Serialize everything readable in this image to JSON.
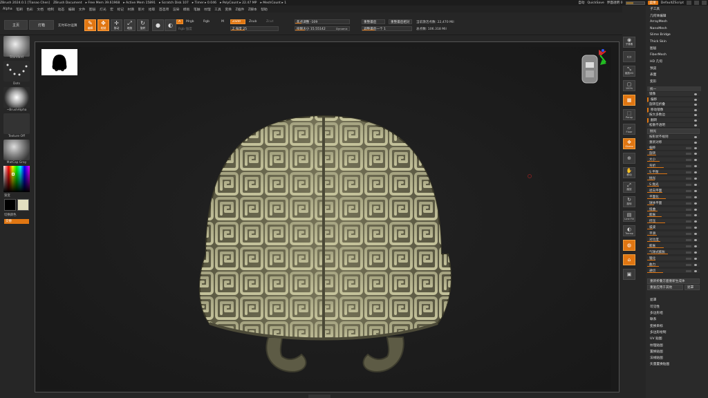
{
  "titlebar": {
    "items": [
      "ZBrush 2024.0.1 [Tianao Chen]",
      "ZBrush Document",
      "▸ Free Mem 39.61968",
      "▸ Active Mem 15891",
      "▸ Scratch Disk 107",
      "▸ Timer ▸ 0.046",
      "▸ PolyCount ▸ 22.47 MP",
      "▸ MeshCount ▸ 1"
    ]
  },
  "topright": {
    "autosave": "自动",
    "quicksave": "QuickSave",
    "transparency": "界面透明 0",
    "menus_btn": "菜单",
    "script": "DefaultZScript"
  },
  "menubar": {
    "items": [
      "Alpha",
      "笔刷",
      "色彩",
      "文档",
      "绘制",
      "动态",
      "编辑",
      "文件",
      "图层",
      "灯光",
      "宏",
      "标记",
      "材质",
      "影片",
      "拾取",
      "首选项",
      "渲染",
      "模板",
      "笔触",
      "纹理",
      "工具",
      "变换",
      "Z插件",
      "Z脚本",
      "帮助"
    ]
  },
  "toolbar": {
    "home": "主页",
    "lightbox": "灯箱",
    "live_boolean": "实时布尔运算",
    "tools": [
      {
        "label": "编辑",
        "glyph": "✎",
        "active": true
      },
      {
        "label": "绘制",
        "glyph": "✥",
        "active": true
      },
      {
        "label": "移动",
        "glyph": "✛",
        "active": false
      },
      {
        "label": "缩放",
        "glyph": "⤢",
        "active": false
      },
      {
        "label": "旋转",
        "glyph": "↻",
        "active": false
      }
    ],
    "a_label": "A",
    "mrgb": "Mrgb",
    "rgb": "Rgb",
    "m": "M",
    "rgb_intensity": "Rgb 强度",
    "zadd": "Zadd",
    "zsub": "Zsub",
    "zcut": "Zcut",
    "z_intensity": "Z 强度 25",
    "focal_shift": "焦点调整 -109",
    "draw_size": "绘制大小 15.55142",
    "dynamic": "Dynamic",
    "remap_prev": "重整最后",
    "remap_rel": "重整最后相对",
    "active_points": "当前激活点数: 22,470 Mil",
    "adjust_last": "调整最后一个 1",
    "total_points": "总点数: 106.318 Mil"
  },
  "leftshelf": {
    "brush": "Standard",
    "stroke": "Dots",
    "alpha": "~BrushAlpha",
    "texture": "Texture Off",
    "material": "MatCap Gray",
    "gradient": "渐变",
    "swap_color": "切换颜色",
    "alternate": "交替"
  },
  "rightstrip": {
    "icons": [
      {
        "label": "子像素",
        "glyph": "◉",
        "active": false
      },
      {
        "label": "",
        "glyph": "▭",
        "active": false
      },
      {
        "label": "缩放2D",
        "glyph": "⤡",
        "active": false
      },
      {
        "label": "100%",
        "glyph": "▢",
        "active": false
      },
      {
        "label": "",
        "glyph": "▦",
        "active": true
      },
      {
        "label": "Persp",
        "glyph": "⬚",
        "active": false
      },
      {
        "label": "Floor",
        "glyph": "▱",
        "active": false
      },
      {
        "label": "Gizmo",
        "glyph": "✥",
        "active": true
      },
      {
        "label": "",
        "glyph": "⊕",
        "active": false
      },
      {
        "label": "移动",
        "glyph": "✋",
        "active": false
      },
      {
        "label": "缩放",
        "glyph": "⤢",
        "active": false
      },
      {
        "label": "旋转",
        "glyph": "↻",
        "active": false
      },
      {
        "label": "Line Fill",
        "glyph": "▤",
        "active": false
      },
      {
        "label": "Transp",
        "glyph": "◐",
        "active": false
      },
      {
        "label": "",
        "glyph": "◍",
        "active": true
      },
      {
        "label": "",
        "glyph": "⌂",
        "active": true
      },
      {
        "label": "",
        "glyph": "▣",
        "active": false
      }
    ]
  },
  "palette": {
    "top_items": [
      "子工具",
      "几何体编辑",
      "ArrayMesh",
      "NanoMesh",
      "Slime Bridge",
      "Thick Skin",
      "图层",
      "FiberMesh",
      "HD 几何",
      "预览",
      "表面",
      "变形"
    ],
    "unify": "统一",
    "rows_a": [
      "镜像",
      "偏移",
      "旋转在折叠",
      "移动镜像",
      "按大多数边",
      "翻转",
      "松散不透明"
    ],
    "polish_btn": "抛光",
    "rows_b": [
      "按形状不规则",
      "重新对称"
    ],
    "rows_c": [
      "偏移",
      "旋转",
      "大小",
      "弯折",
      "S 平衡",
      "抛光",
      "S 抛光",
      "径向平面",
      "平面化",
      "球体平面",
      "扭曲",
      "膨胀",
      "挤压",
      "噪波",
      "平滑",
      "对比度",
      "膨胀",
      "气球式膨胀",
      "锥化",
      "曲力",
      "通切"
    ],
    "apply_btn": "重新折叠方面重新生成体",
    "apply_a": "重复应用于其他",
    "apply_b": "遮罩",
    "bottom_items": [
      "遮罩",
      "可见性",
      "多边形组",
      "联系",
      "变换目标",
      "多边形绘制",
      "UV 贴图",
      "纹理贴图",
      "置换贴图",
      "法线贴图",
      "矢量置换贴图"
    ]
  },
  "colors": {
    "accent": "#e07612",
    "helmet_base": "#6e6b52",
    "helmet_relief": "#bcbb93"
  }
}
